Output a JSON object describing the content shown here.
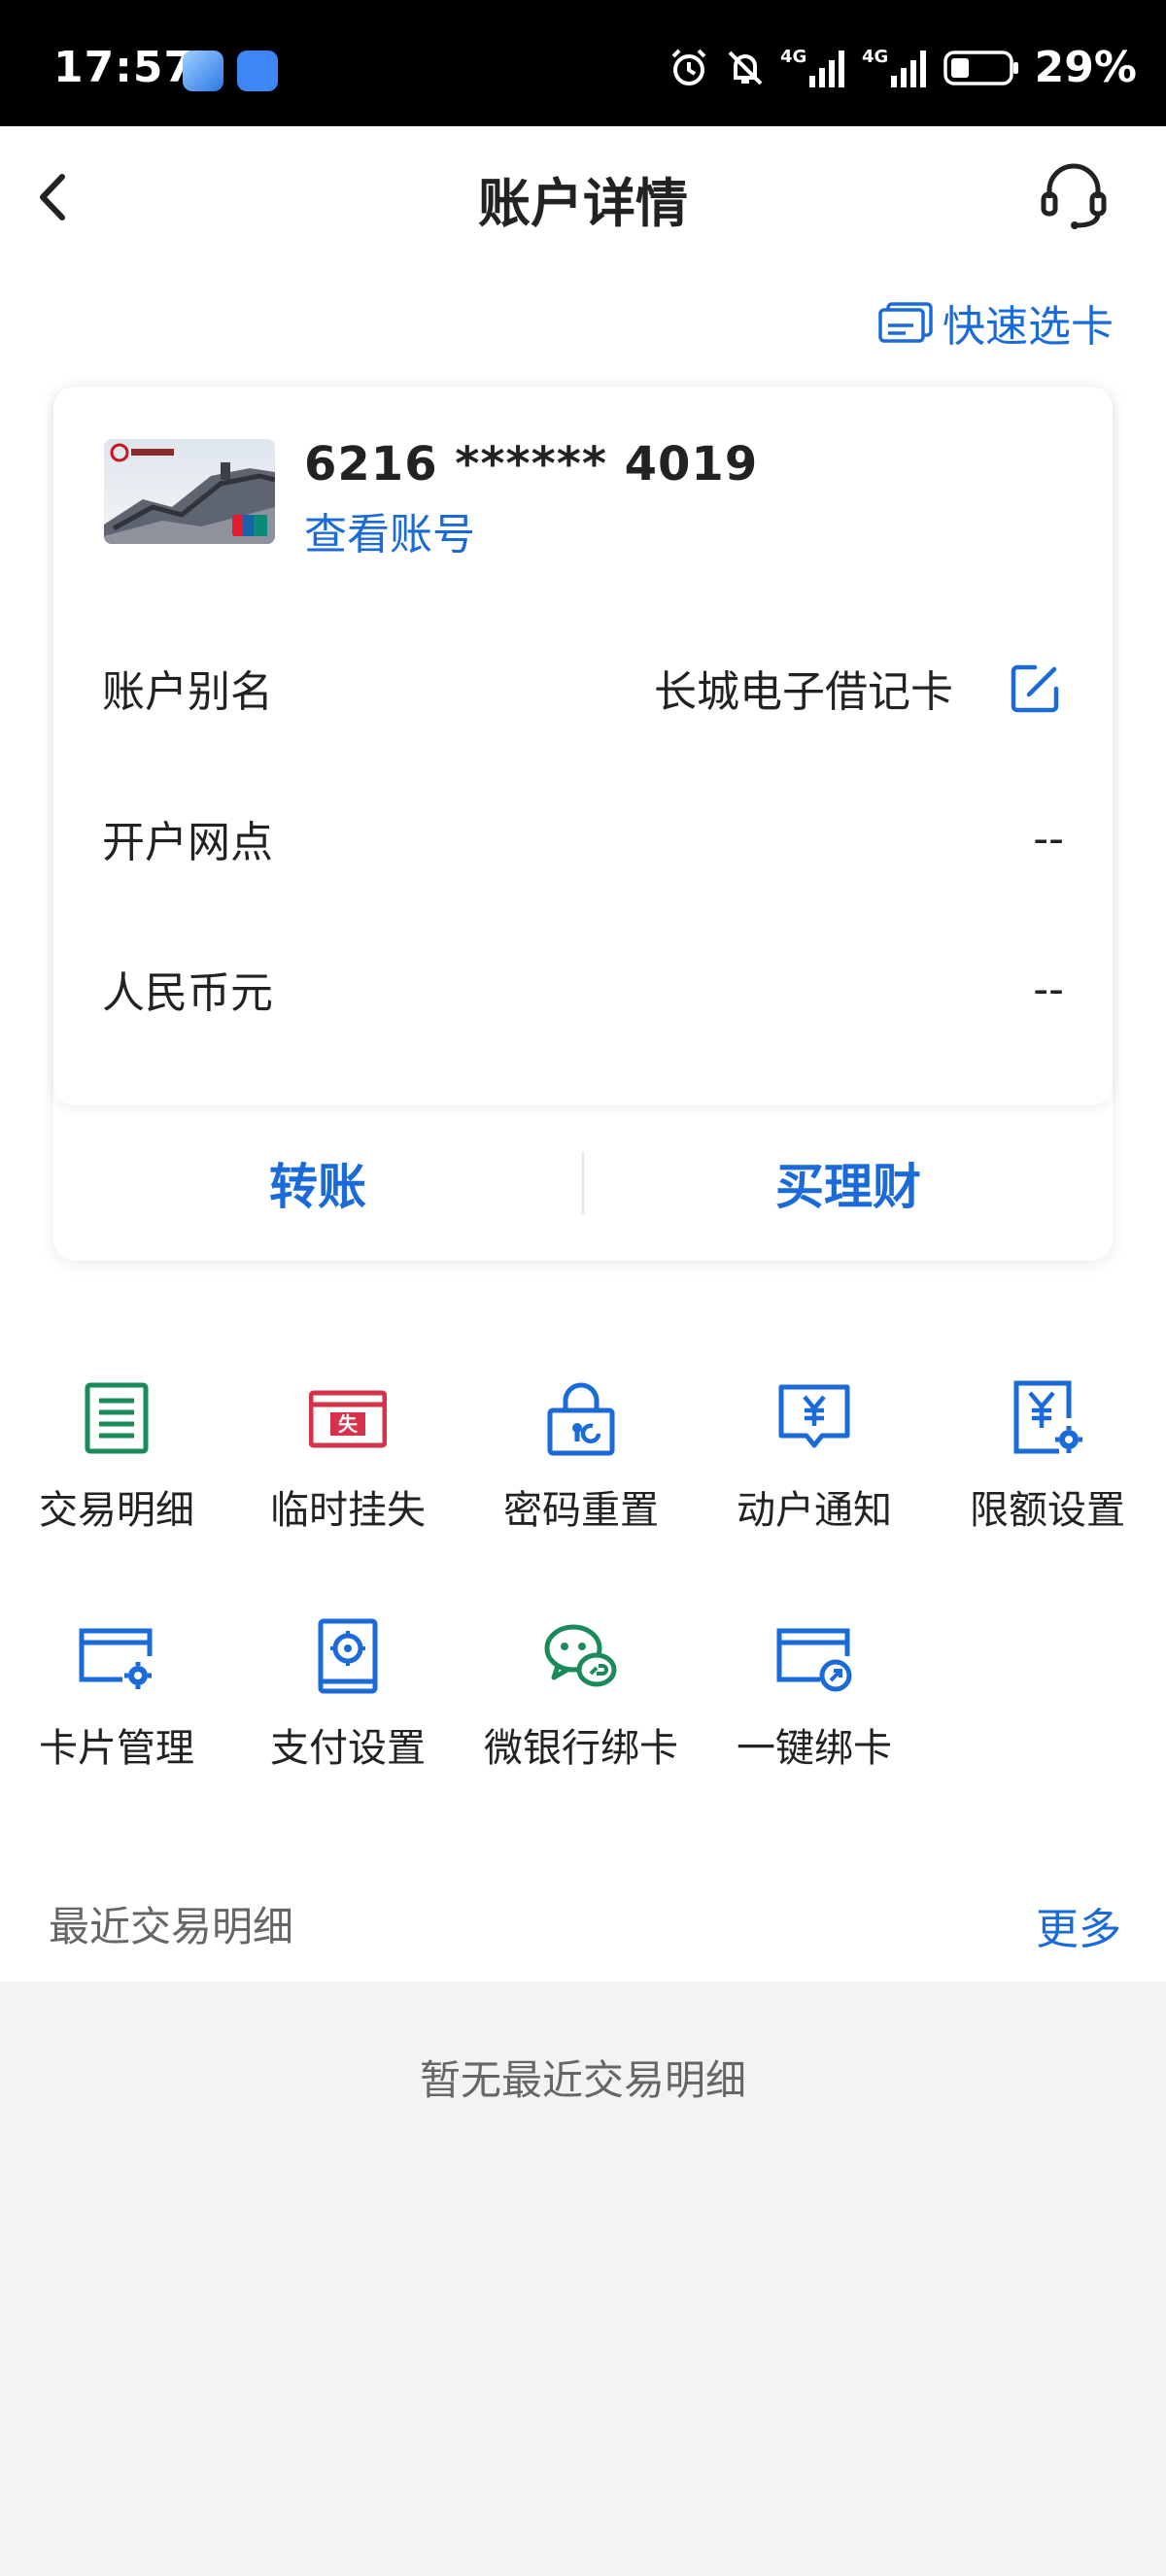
{
  "status_bar": {
    "time": "17:57",
    "battery": "29%",
    "network": "4G"
  },
  "nav": {
    "title": "账户详情",
    "back_icon": "chevron-left-icon",
    "service_icon": "headset-icon"
  },
  "quick_select": {
    "label": "快速选卡",
    "icon": "card-list-icon"
  },
  "card": {
    "number": "6216 ****** 4019",
    "view_account": "查看账号",
    "rows": [
      {
        "label": "账户别名",
        "value": "长城电子借记卡"
      },
      {
        "label": "开户网点",
        "value": "--"
      },
      {
        "label": "人民币元",
        "value": "--"
      }
    ],
    "actions": {
      "transfer": "转账",
      "buy_finance": "买理财"
    }
  },
  "functions": [
    {
      "label": "交易明细",
      "icon": "document-list-icon",
      "color": "#1a8a5a"
    },
    {
      "label": "临时挂失",
      "icon": "lost-card-icon",
      "color": "#d8324a"
    },
    {
      "label": "密码重置",
      "icon": "lock-reset-icon",
      "color": "#1a6ad9"
    },
    {
      "label": "动户通知",
      "icon": "yuan-message-icon",
      "color": "#1a6ad9"
    },
    {
      "label": "限额设置",
      "icon": "yuan-gear-icon",
      "color": "#1a6ad9"
    },
    {
      "label": "卡片管理",
      "icon": "card-gear-icon",
      "color": "#1a6ad9"
    },
    {
      "label": "支付设置",
      "icon": "safe-icon",
      "color": "#1a6ad9"
    },
    {
      "label": "微银行绑卡",
      "icon": "wechat-link-icon",
      "color": "#1a8a5a"
    },
    {
      "label": "一键绑卡",
      "icon": "card-link-icon",
      "color": "#1a6ad9"
    }
  ],
  "recent": {
    "title": "最近交易明细",
    "more": "更多",
    "empty": "暂无最近交易明细"
  },
  "colors": {
    "accent": "#1a6ad9",
    "green": "#1a8a5a",
    "red": "#d8324a",
    "background": "#f3f3f3"
  }
}
